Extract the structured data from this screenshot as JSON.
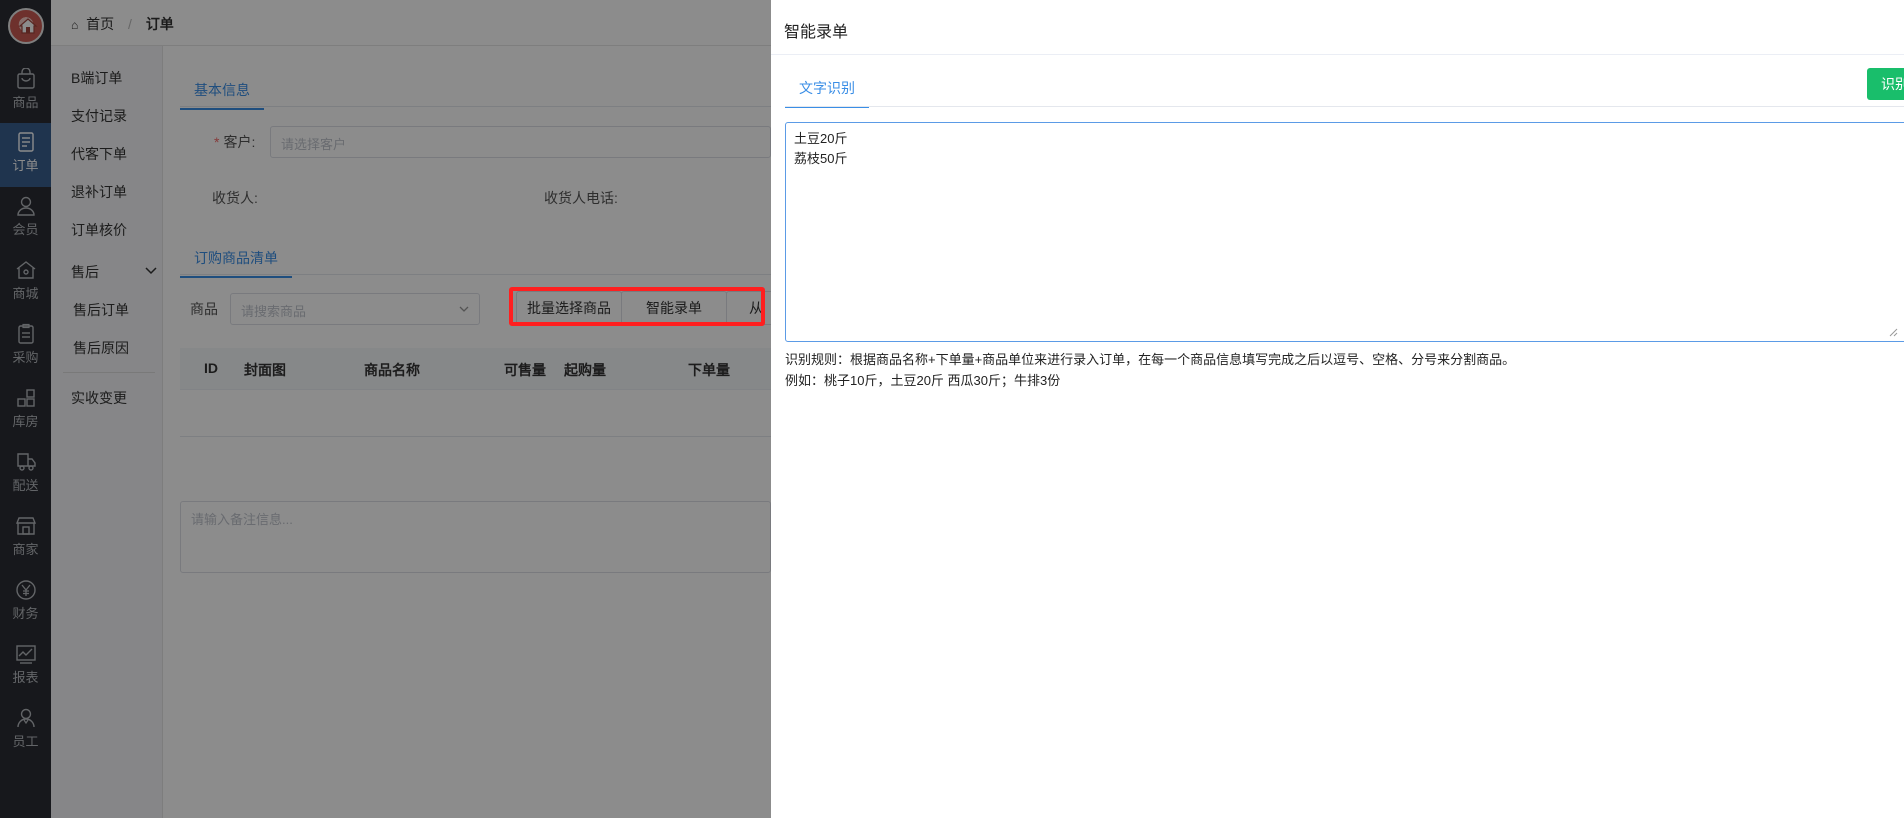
{
  "header": {
    "breadcrumb": [
      "首页",
      "订单"
    ]
  },
  "rail": {
    "items": [
      {
        "label": "商品",
        "icon": "bag-icon"
      },
      {
        "label": "订单",
        "icon": "document-icon",
        "active": true
      },
      {
        "label": "会员",
        "icon": "user-icon"
      },
      {
        "label": "商城",
        "icon": "home-icon"
      },
      {
        "label": "采购",
        "icon": "clipboard-icon"
      },
      {
        "label": "库房",
        "icon": "grid-icon"
      },
      {
        "label": "配送",
        "icon": "delivery-icon"
      },
      {
        "label": "商家",
        "icon": "store-icon"
      },
      {
        "label": "财务",
        "icon": "yen-icon"
      },
      {
        "label": "报表",
        "icon": "chart-icon"
      },
      {
        "label": "员工",
        "icon": "staff-icon"
      }
    ]
  },
  "submenu": {
    "items": [
      "B端订单",
      "支付记录",
      "代客下单",
      "退补订单",
      "订单核价"
    ],
    "aftersale": {
      "group": "售后",
      "children": [
        "售后订单",
        "售后原因"
      ]
    },
    "bottom": "实收变更"
  },
  "form": {
    "basic_tab": "基本信息",
    "customer_label": "客户:",
    "customer_required": "*",
    "customer_placeholder": "请选择客户",
    "consignee_label": "收货人:",
    "consignee_phone_label": "收货人电话:",
    "goods_tab": "订购商品清单",
    "goods_label": "商品",
    "goods_placeholder": "请搜索商品",
    "batch_select_button": "批量选择商品",
    "smart_entry_button": "智能录单",
    "third_button_partial": "从",
    "table_headers": [
      "ID",
      "封面图",
      "商品名称",
      "可售量",
      "起购量",
      "下单量"
    ],
    "remark_placeholder": "请输入备注信息..."
  },
  "drawer": {
    "title": "智能录单",
    "tab": "文字识别",
    "recognize_button": "识别",
    "text_lines": [
      "土豆20斤",
      "荔枝50斤"
    ],
    "rule_text": "识别规则：根据商品名称+下单量+商品单位来进行录入订单，在每一个商品信息填写完成之后以逗号、空格、分号来分割商品。",
    "example_text": "例如：桃子10斤，土豆20斤 西瓜30斤；牛排3份"
  },
  "colors": {
    "rail_bg": "#2a2d33",
    "rail_active": "#39608f",
    "primary": "#3a8ee6",
    "success": "#19be6b",
    "highlight": "#ff1f1f"
  }
}
